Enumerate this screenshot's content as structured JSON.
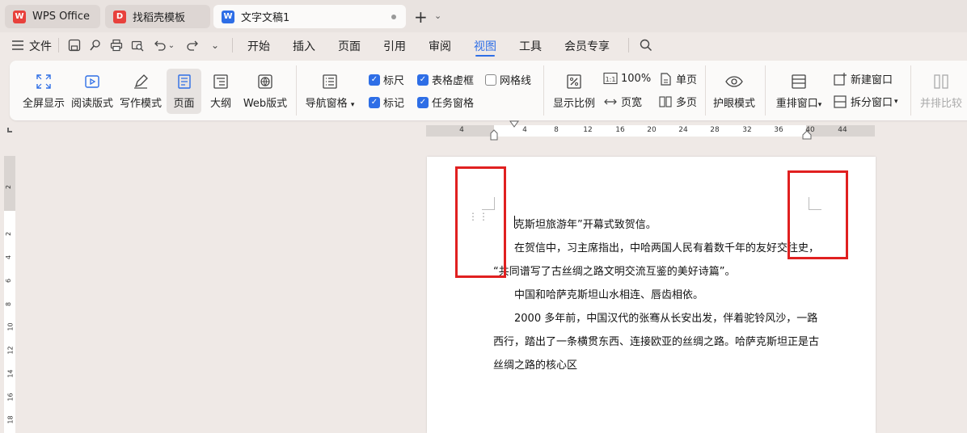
{
  "tabs": [
    {
      "label": "WPS Office",
      "icon": "wps-logo-icon"
    },
    {
      "label": "找稻壳模板",
      "icon": "docer-logo-icon"
    },
    {
      "label": "文字文稿1",
      "icon": "writer-doc-icon"
    }
  ],
  "menu": {
    "file_label": "文件",
    "items": [
      "开始",
      "插入",
      "页面",
      "引用",
      "审阅",
      "视图",
      "工具",
      "会员专享"
    ],
    "active": "视图"
  },
  "ribbon": {
    "view_buttons": [
      "全屏显示",
      "阅读版式",
      "写作模式",
      "页面",
      "大纲",
      "Web版式"
    ],
    "nav_pane": "导航窗格",
    "checkboxes": [
      {
        "label": "标尺",
        "checked": true
      },
      {
        "label": "表格虚框",
        "checked": true
      },
      {
        "label": "网格线",
        "checked": false
      },
      {
        "label": "标记",
        "checked": true
      },
      {
        "label": "任务窗格",
        "checked": true
      }
    ],
    "zoom_label": "显示比例",
    "zoom_100": "100%",
    "page_width": "页宽",
    "single_page": "单页",
    "multi_page": "多页",
    "eye_mode": "护眼模式",
    "arrange_window": "重排窗口",
    "new_window": "新建窗口",
    "split_window": "拆分窗口",
    "side_by_side": "并排比较"
  },
  "ruler": {
    "h_ticks": [
      "4",
      "4",
      "8",
      "12",
      "16",
      "20",
      "24",
      "28",
      "32",
      "36",
      "40",
      "44"
    ],
    "v_ticks": [
      "2",
      "2",
      "4",
      "6",
      "8",
      "10",
      "12",
      "14",
      "16",
      "18"
    ]
  },
  "document": {
    "paragraphs": [
      "克斯坦旅游年”开幕式致贺信。",
      "在贺信中，习主席指出，中哈两国人民有着数千年的友好交往史，",
      "“共同谱写了古丝绸之路文明交流互鉴的美好诗篇”。",
      "中国和哈萨克斯坦山水相连、唇齿相依。",
      "2000 多年前，中国汉代的张骞从长安出发，伴着驼铃风沙，一路",
      "西行，踏出了一条横贯东西、连接欧亚的丝绸之路。哈萨克斯坦正是古",
      "丝绸之路的核心区"
    ]
  },
  "colors": {
    "accent": "#2e6ee6",
    "highlight_box": "#e02020",
    "wps_red": "#e8413c"
  }
}
